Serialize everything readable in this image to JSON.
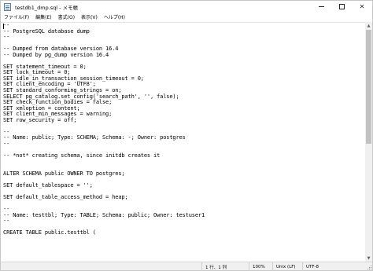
{
  "window": {
    "title": "testdb1_dmp.sql - メモ帳",
    "controls": {
      "minimize": "",
      "maximize": "",
      "close": "✕"
    }
  },
  "menu": {
    "items": [
      "ファイル(F)",
      "編集(E)",
      "書式(O)",
      "表示(V)",
      "ヘルプ(H)"
    ]
  },
  "editor": {
    "lines": [
      "--",
      "-- PostgreSQL database dump",
      "--",
      "",
      "-- Dumped from database version 16.4",
      "-- Dumped by pg_dump version 16.4",
      "",
      "SET statement_timeout = 0;",
      "SET lock_timeout = 0;",
      "SET idle_in_transaction_session_timeout = 0;",
      "SET client_encoding = 'UTF8';",
      "SET standard_conforming_strings = on;",
      "SELECT pg_catalog.set_config('search_path', '', false);",
      "SET check_function_bodies = false;",
      "SET xmloption = content;",
      "SET client_min_messages = warning;",
      "SET row_security = off;",
      "",
      "--",
      "-- Name: public; Type: SCHEMA; Schema: -; Owner: postgres",
      "--",
      "",
      "-- *not* creating schema, since initdb creates it",
      "",
      "",
      "ALTER SCHEMA public OWNER TO postgres;",
      "",
      "SET default_tablespace = '';",
      "",
      "SET default_table_access_method = heap;",
      "",
      "--",
      "-- Name: testtbl; Type: TABLE; Schema: public; Owner: testuser1",
      "--",
      "",
      "CREATE TABLE public.testtbl ("
    ]
  },
  "status": {
    "position": "1 行、1 列",
    "zoom": "100%",
    "eol": "Unix (LF)",
    "encoding": "UTF-8"
  },
  "scrollbar": {
    "up_arrow": "▲",
    "down_arrow": "▼"
  }
}
